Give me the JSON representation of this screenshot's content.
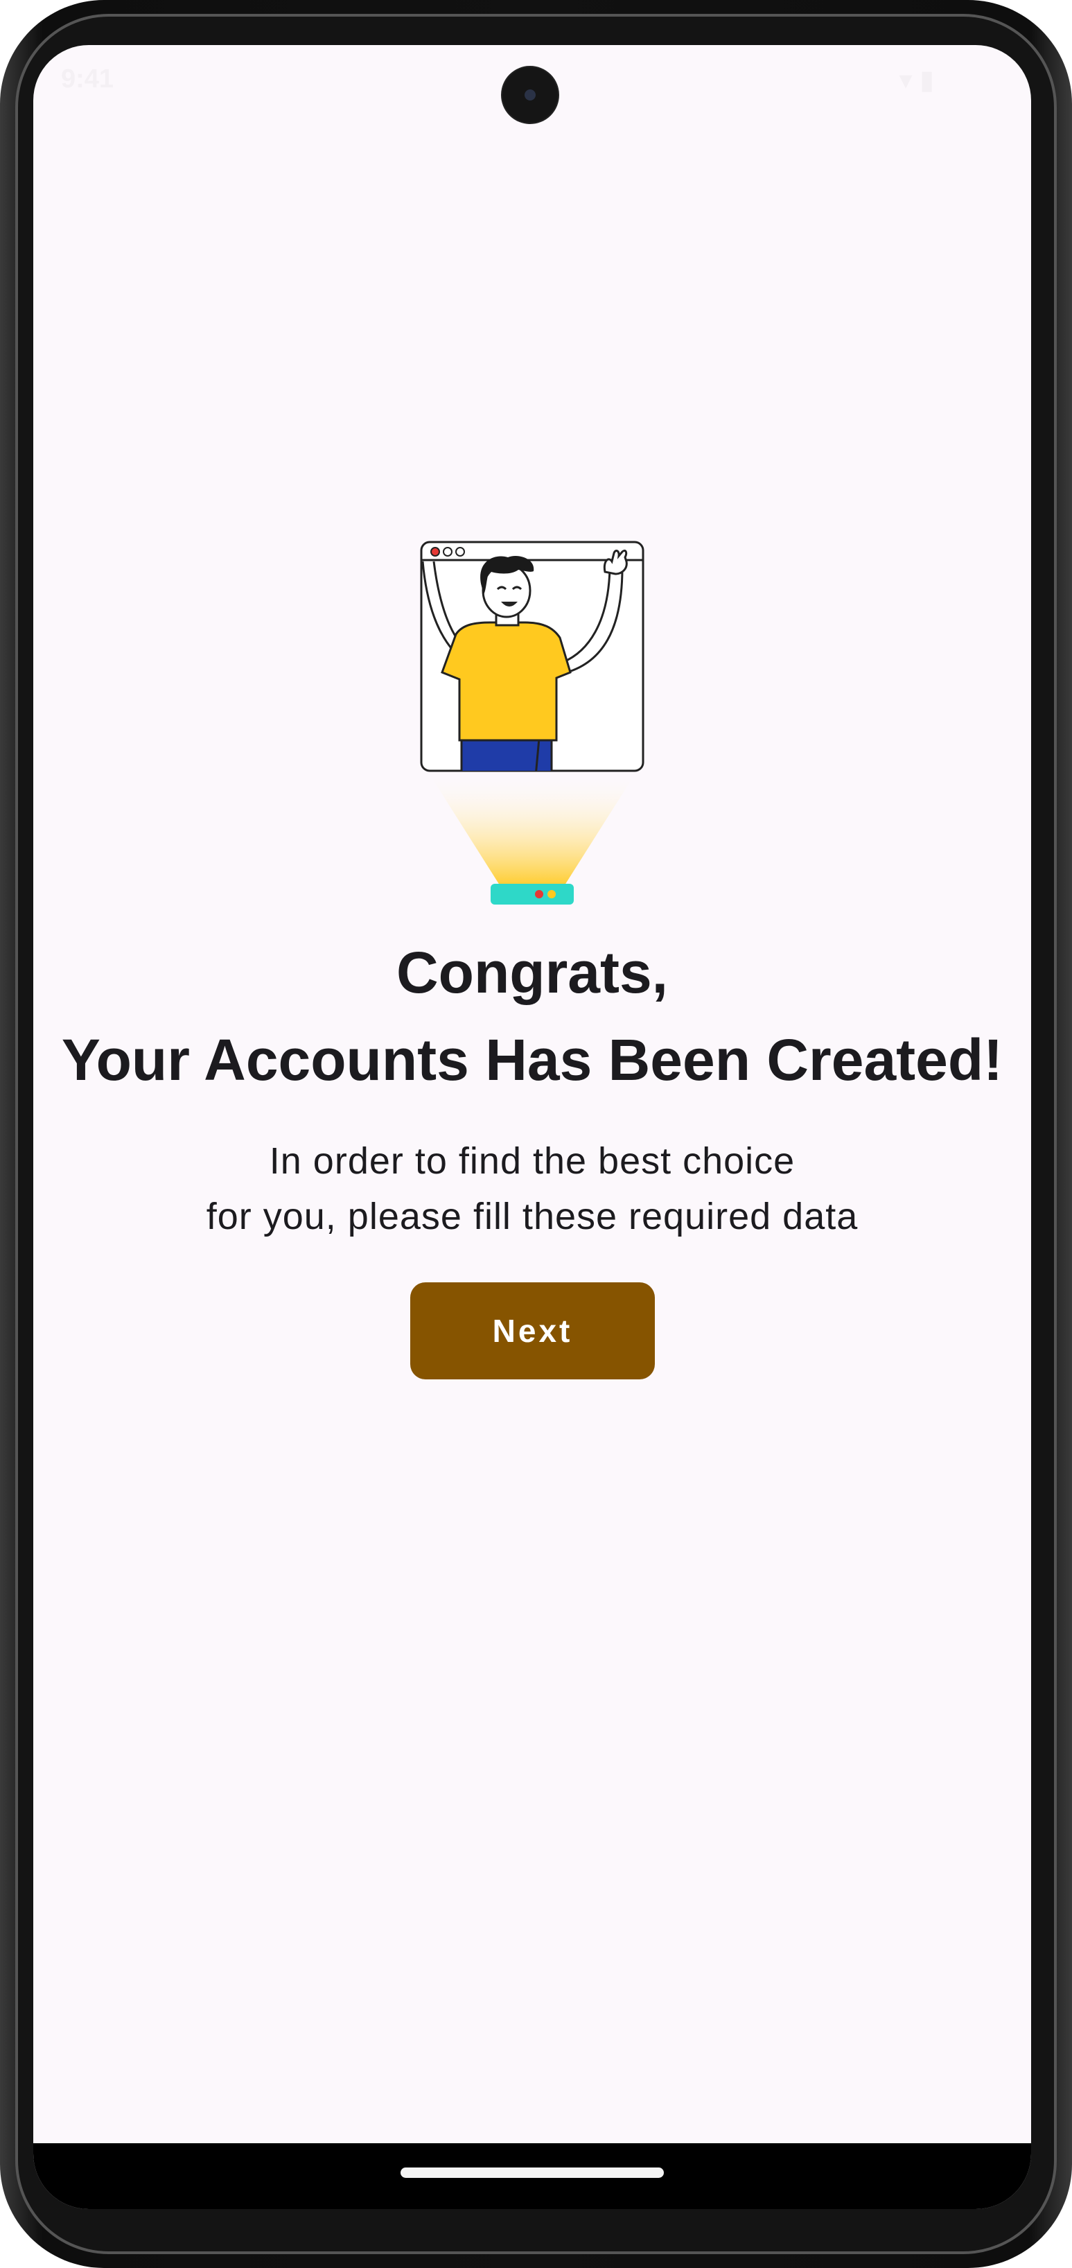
{
  "status_bar": {
    "time": "9:41",
    "right": "▾ ▮"
  },
  "onboarding": {
    "title_line1": "Congrats,",
    "title_line2": "Your Accounts Has Been Created!",
    "subtitle_line1": "In order to find the best choice",
    "subtitle_line2": "for you, please fill these required data",
    "next_label": "Next"
  },
  "colors": {
    "background": "#fcf8fc",
    "primary_button": "#865400",
    "shirt": "#ffc91f",
    "pants": "#1f3ca8",
    "projector": "#2ed8c8"
  },
  "icons": {
    "illustration": "person-in-browser-window-illustration",
    "camera": "front-camera-icon"
  }
}
